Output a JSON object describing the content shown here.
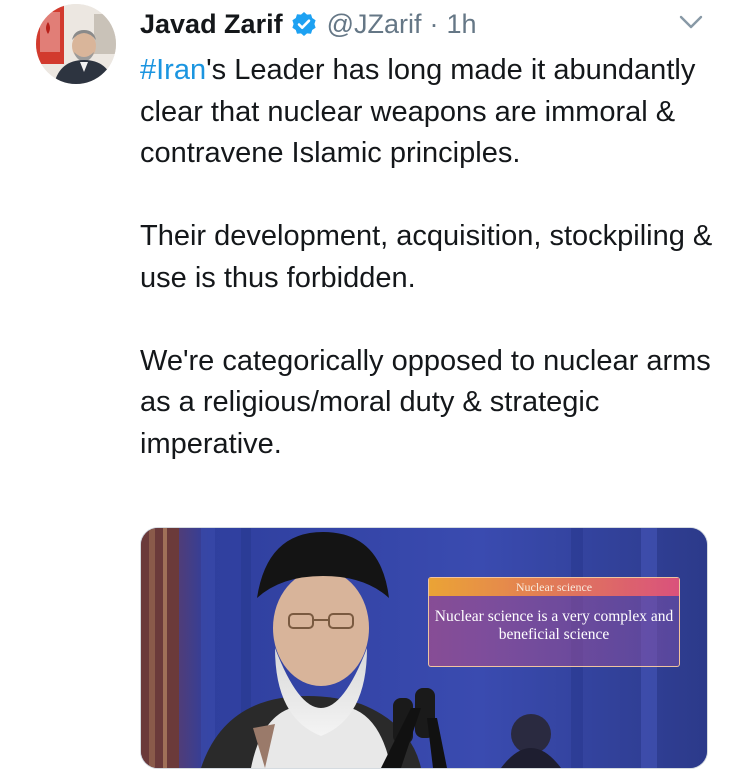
{
  "author": {
    "display_name": "Javad Zarif",
    "handle": "@JZarif",
    "separator": "·",
    "time": "1h",
    "verified_icon": "verified-badge-icon"
  },
  "tweet": {
    "hashtag": "#Iran",
    "line1_rest": "'s Leader has long made it abundantly clear that nuclear weapons are immoral & contravene Islamic principles.",
    "paragraph2": "Their development, acquisition, stockpiling & use is thus forbidden.",
    "paragraph3": "We're categorically opposed to nuclear arms as a religious/moral duty & strategic imperative."
  },
  "media": {
    "caption_header": "Nuclear science",
    "caption_text": "Nuclear science is a very complex and beneficial science"
  },
  "colors": {
    "link": "#1b95e0",
    "verified": "#1da1f2",
    "secondary_text": "#657786",
    "primary_text": "#14171a"
  },
  "icons": {
    "caret": "chevron-down-icon",
    "avatar": "avatar"
  }
}
